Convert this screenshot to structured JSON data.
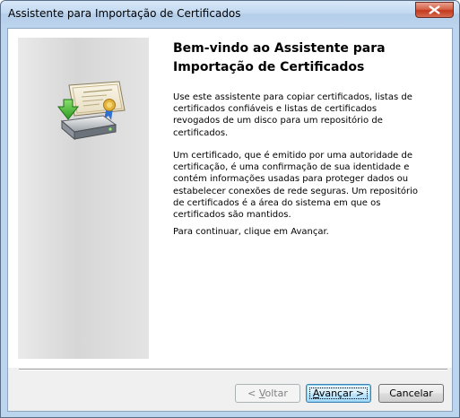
{
  "window": {
    "title": "Assistente para Importação de Certificados",
    "close_icon": "close-icon"
  },
  "banner": {
    "icon": "certificate-import-icon"
  },
  "content": {
    "heading_line1": "Bem-vindo ao Assistente para",
    "heading_line2": "Importação de Certificados",
    "paragraph1": "Use este assistente para copiar certificados, listas de certificados confiáveis e listas de certificados revogados de um disco para um repositório de certificados.",
    "paragraph2": "Um certificado, que é emitido por uma autoridade de certificação, é uma confirmação de sua identidade e contém informações usadas para proteger dados ou estabelecer conexões de rede seguras. Um repositório de certificados é a área do sistema em que os certificados são mantidos.",
    "paragraph3": "Para continuar, clique em Avançar."
  },
  "buttons": {
    "back_prefix": "< ",
    "back_mnemonic": "V",
    "back_rest": "oltar",
    "back_enabled": false,
    "next_mnemonic": "A",
    "next_rest": "vançar >",
    "cancel_label": "Cancelar"
  },
  "colors": {
    "title_bar": "#c4daf1",
    "close_button": "#c2391c",
    "default_button_border": "#3c7fb1"
  }
}
